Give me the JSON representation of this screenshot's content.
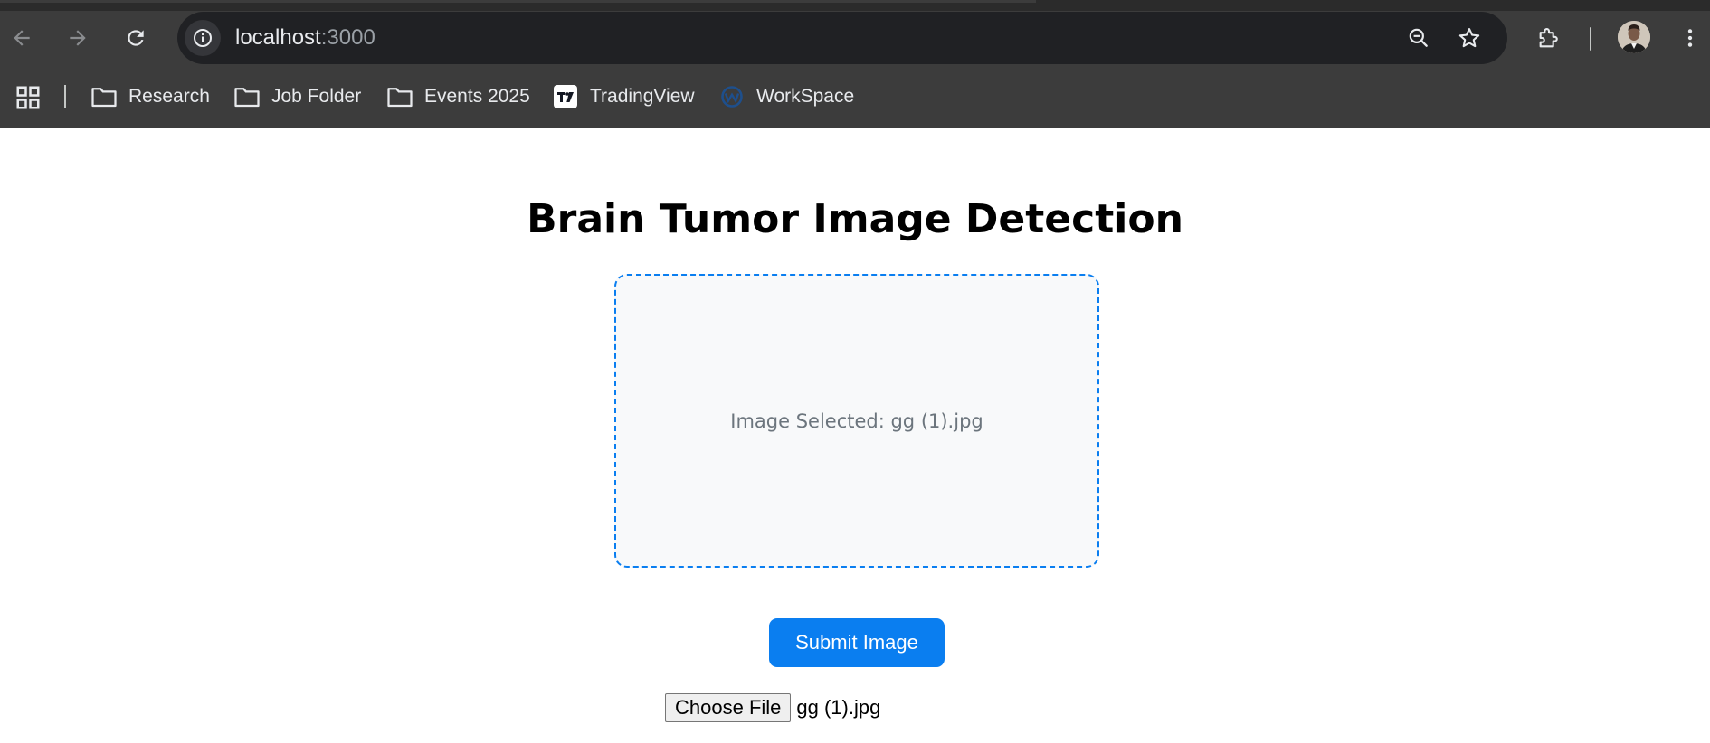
{
  "browser": {
    "url_host": "localhost",
    "url_port": ":3000",
    "icons": {
      "back": "back-arrow-icon",
      "forward": "forward-arrow-icon",
      "reload": "reload-icon",
      "site_info": "info-icon",
      "zoom": "zoom-out-icon",
      "bookmark": "star-icon",
      "extensions": "puzzle-icon",
      "menu": "kebab-menu-icon"
    },
    "colors": {
      "chrome_bg": "#3c3c3c",
      "omnibox_bg": "#202124",
      "text": "#e8eaed"
    }
  },
  "bookmarks": {
    "items": [
      {
        "label": "Research",
        "icon": "folder-icon"
      },
      {
        "label": "Job Folder",
        "icon": "folder-icon"
      },
      {
        "label": "Events 2025",
        "icon": "folder-icon"
      },
      {
        "label": "TradingView",
        "icon": "tradingview-logo"
      },
      {
        "label": "WorkSpace",
        "icon": "workspace-logo"
      }
    ]
  },
  "page": {
    "title": "Brain Tumor Image Detection",
    "dropzone_text": "Image Selected: gg (1).jpg",
    "submit_label": "Submit Image",
    "choose_file_label": "Choose File",
    "file_name": "gg (1).jpg",
    "colors": {
      "accent": "#0a7ef0",
      "dropzone_bg": "#f8f9fa",
      "muted_text": "#6c757d"
    }
  }
}
